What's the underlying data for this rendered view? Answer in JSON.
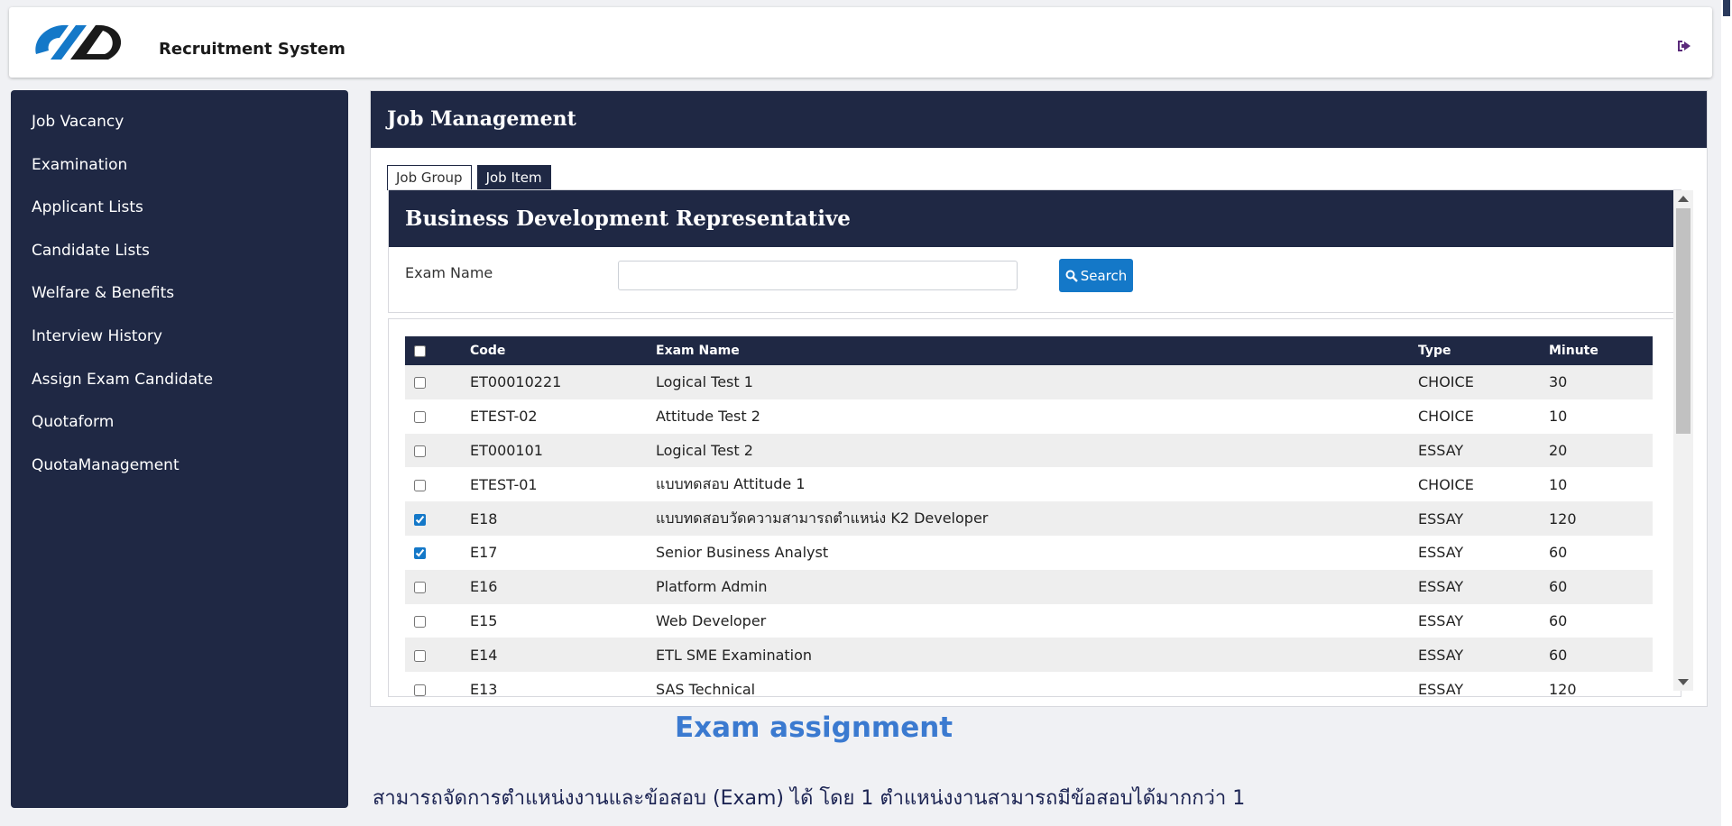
{
  "header": {
    "app_title": "Recruitment System",
    "logout_icon": "logout-icon"
  },
  "sidebar": {
    "items": [
      {
        "label": "Job Vacancy"
      },
      {
        "label": "Examination"
      },
      {
        "label": "Applicant Lists"
      },
      {
        "label": "Candidate Lists"
      },
      {
        "label": "Welfare & Benefits"
      },
      {
        "label": "Interview History"
      },
      {
        "label": "Assign Exam Candidate"
      },
      {
        "label": "Quotaform"
      },
      {
        "label": "QuotaManagement"
      }
    ]
  },
  "main": {
    "title": "Job Management",
    "tabs": [
      {
        "label": "Job Group",
        "active": false
      },
      {
        "label": "Job Item",
        "active": true
      }
    ],
    "panel_title": "Business Development Representative",
    "search": {
      "label": "Exam Name",
      "value": "",
      "placeholder": "",
      "button_label": "Search"
    },
    "table": {
      "headers": {
        "code": "Code",
        "name": "Exam Name",
        "type": "Type",
        "minute": "Minute"
      },
      "rows": [
        {
          "checked": false,
          "code": "ET00010221",
          "name": "Logical Test 1",
          "type": "CHOICE",
          "minute": "30"
        },
        {
          "checked": false,
          "code": "ETEST-02",
          "name": "Attitude Test 2",
          "type": "CHOICE",
          "minute": "10"
        },
        {
          "checked": false,
          "code": "ET000101",
          "name": "Logical Test 2",
          "type": "ESSAY",
          "minute": "20"
        },
        {
          "checked": false,
          "code": "ETEST-01",
          "name": "แบบทดสอบ Attitude 1",
          "type": "CHOICE",
          "minute": "10"
        },
        {
          "checked": true,
          "code": "E18",
          "name": "แบบทดสอบวัดความสามารถตำแหน่ง K2 Developer",
          "type": "ESSAY",
          "minute": "120"
        },
        {
          "checked": true,
          "code": "E17",
          "name": "Senior Business Analyst",
          "type": "ESSAY",
          "minute": "60"
        },
        {
          "checked": false,
          "code": "E16",
          "name": "Platform Admin",
          "type": "ESSAY",
          "minute": "60"
        },
        {
          "checked": false,
          "code": "E15",
          "name": "Web Developer",
          "type": "ESSAY",
          "minute": "60"
        },
        {
          "checked": false,
          "code": "E14",
          "name": "ETL SME Examination",
          "type": "ESSAY",
          "minute": "60"
        },
        {
          "checked": false,
          "code": "E13",
          "name": "SAS Technical",
          "type": "ESSAY",
          "minute": "120"
        }
      ]
    }
  },
  "caption": "Exam assignment",
  "footnote": "สามารถจัดการตำแหน่งงานและข้อสอบ (Exam) ได้ โดย 1 ตำแหน่งงานสามารถมีข้อสอบได้มากกว่า 1",
  "colors": {
    "navy": "#1f2844",
    "accent_blue": "#1478c8",
    "caption_blue": "#3b7ad0"
  }
}
